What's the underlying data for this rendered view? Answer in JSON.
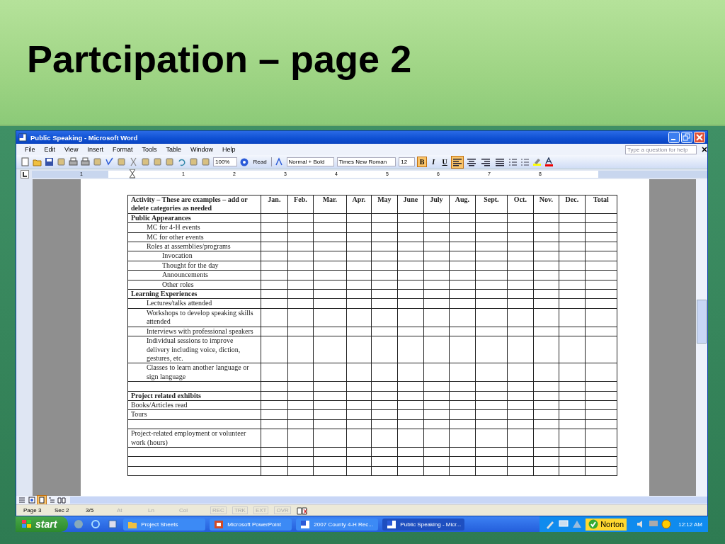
{
  "slide": {
    "title": "Partcipation – page 2"
  },
  "window": {
    "title": "Public Speaking - Microsoft Word"
  },
  "menu": [
    "File",
    "Edit",
    "View",
    "Insert",
    "Format",
    "Tools",
    "Table",
    "Window",
    "Help"
  ],
  "help_box": {
    "placeholder": "Type a question for help"
  },
  "toolbar": {
    "zoom": "100%",
    "read": "Read",
    "style": "Normal + Bold",
    "font": "Times New Roman",
    "size": "12",
    "format_buttons": [
      {
        "label": "B",
        "selected": true
      },
      {
        "label": "I",
        "selected": false
      },
      {
        "label": "U",
        "selected": false
      }
    ],
    "alignment": [
      {
        "kind": "left",
        "selected": true
      },
      {
        "kind": "center",
        "selected": false
      },
      {
        "kind": "right",
        "selected": false
      },
      {
        "kind": "justify",
        "selected": false
      }
    ]
  },
  "ruler": {
    "labels": [
      "1",
      "1",
      "2",
      "3",
      "4",
      "5",
      "6",
      "7",
      "8"
    ]
  },
  "table": {
    "columns": [
      "Activity – These are examples – add or delete categories as needed",
      "Jan.",
      "Feb.",
      "Mar.",
      "Apr.",
      "May",
      "June",
      "July",
      "Aug.",
      "Sept.",
      "Oct.",
      "Nov.",
      "Dec.",
      "Total"
    ],
    "rows": [
      {
        "kind": "heading",
        "label": "Public Appearances",
        "children": [
          {
            "kind": "item",
            "label": "MC for 4-H events"
          },
          {
            "kind": "item",
            "label": "MC for other events"
          },
          {
            "kind": "item",
            "label": "Roles at assemblies/programs",
            "children": [
              {
                "kind": "item",
                "label": "Invocation"
              },
              {
                "kind": "item",
                "label": "Thought for the day"
              },
              {
                "kind": "item",
                "label": "Announcements"
              },
              {
                "kind": "item",
                "label": "Other roles"
              }
            ]
          }
        ]
      },
      {
        "kind": "heading",
        "label": "Learning Experiences",
        "children": [
          {
            "kind": "item",
            "label": "Lectures/talks attended"
          },
          {
            "kind": "item",
            "label": "Workshops to develop speaking skills attended"
          },
          {
            "kind": "item",
            "label": "Interviews with professional speakers"
          },
          {
            "kind": "item",
            "label": "Individual sessions to improve delivery including voice, diction, gestures, etc."
          },
          {
            "kind": "item",
            "label": "Classes to learn another language or sign language"
          }
        ]
      },
      {
        "kind": "blank"
      },
      {
        "kind": "heading",
        "label": "Project related exhibits"
      },
      {
        "kind": "item",
        "label": "Books/Articles read"
      },
      {
        "kind": "item",
        "label": "Tours"
      },
      {
        "kind": "blank"
      },
      {
        "kind": "item",
        "label": "Project-related employment or volunteer work (hours)"
      },
      {
        "kind": "blank"
      },
      {
        "kind": "blank"
      },
      {
        "kind": "blank"
      }
    ]
  },
  "view_buttons": [
    {
      "kind": "normal",
      "selected": false
    },
    {
      "kind": "web",
      "selected": false
    },
    {
      "kind": "print",
      "selected": true
    },
    {
      "kind": "outline",
      "selected": false
    },
    {
      "kind": "reading",
      "selected": false
    }
  ],
  "status_bar": [
    {
      "text": "Page 3",
      "disabled": false
    },
    {
      "text": "Sec 2",
      "disabled": false
    },
    {
      "text": "3/5",
      "disabled": false
    },
    {
      "text": "At",
      "disabled": true
    },
    {
      "text": "Ln",
      "disabled": true
    },
    {
      "text": "Col",
      "disabled": true
    },
    {
      "text": "REC",
      "disabled": true
    },
    {
      "text": "TRK",
      "disabled": true
    },
    {
      "text": "EXT",
      "disabled": true
    },
    {
      "text": "OVR",
      "disabled": true
    }
  ],
  "taskbar": {
    "start": "start",
    "tasks": [
      {
        "label": "Project Sheets",
        "kind": "folder",
        "selected": false
      },
      {
        "label": "Microsoft PowerPoint",
        "kind": "powerpoint",
        "selected": false
      },
      {
        "label": "2007 County 4-H Rec...",
        "kind": "word",
        "selected": false
      },
      {
        "label": "Public Speaking - Micr...",
        "kind": "word",
        "selected": true
      }
    ],
    "norton": "Norton",
    "clock": "12:12 AM"
  }
}
